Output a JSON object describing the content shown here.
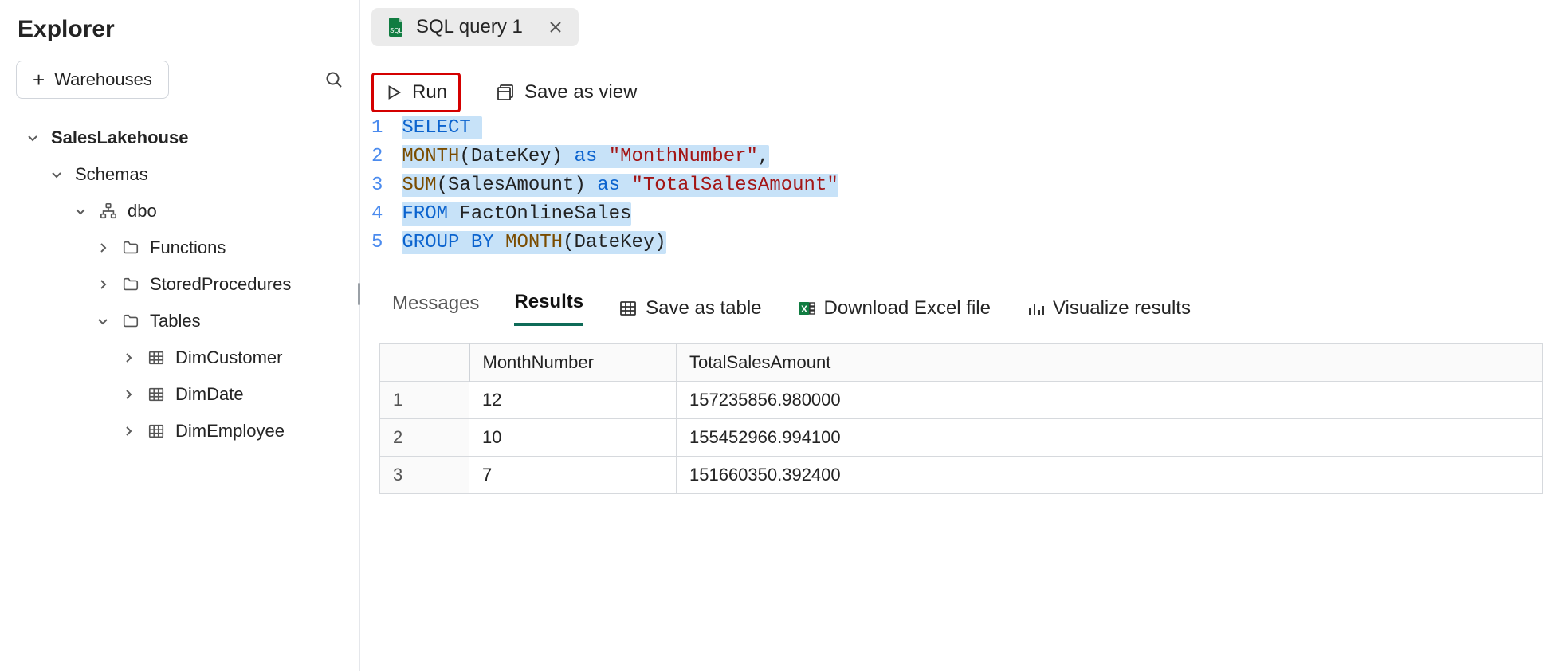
{
  "explorer": {
    "title": "Explorer",
    "add_warehouses_label": "Warehouses",
    "tree": {
      "root": "SalesLakehouse",
      "schemas_label": "Schemas",
      "dbo_label": "dbo",
      "functions_label": "Functions",
      "stored_procs_label": "StoredProcedures",
      "tables_label": "Tables",
      "tables": {
        "t0": "DimCustomer",
        "t1": "DimDate",
        "t2": "DimEmployee"
      }
    }
  },
  "tab": {
    "label": "SQL query 1"
  },
  "toolbar": {
    "run_label": "Run",
    "save_view_label": "Save as view"
  },
  "code": {
    "lines": [
      "1",
      "2",
      "3",
      "4",
      "5"
    ],
    "l1": {
      "select": "SELECT"
    },
    "l2": {
      "fn": "MONTH",
      "open": "(",
      "arg": "DateKey",
      "close": ")",
      "as": "as",
      "alias": "\"MonthNumber\"",
      "comma": ","
    },
    "l3": {
      "fn": "SUM",
      "open": "(",
      "arg": "SalesAmount",
      "close": ")",
      "as": "as",
      "alias": "\"TotalSalesAmount\""
    },
    "l4": {
      "from": "FROM",
      "tbl": "FactOnlineSales"
    },
    "l5": {
      "group": "GROUP",
      "by": "BY",
      "fn": "MONTH",
      "open": "(",
      "arg": "DateKey",
      "close": ")"
    }
  },
  "results": {
    "messages_tab": "Messages",
    "results_tab": "Results",
    "save_table": "Save as table",
    "download_excel": "Download Excel file",
    "visualize": "Visualize results",
    "headers": {
      "col1": "MonthNumber",
      "col2": "TotalSalesAmount"
    },
    "rows": [
      {
        "n": "1",
        "c1": "12",
        "c2": "157235856.980000"
      },
      {
        "n": "2",
        "c1": "10",
        "c2": "155452966.994100"
      },
      {
        "n": "3",
        "c1": "7",
        "c2": "151660350.392400"
      }
    ]
  }
}
